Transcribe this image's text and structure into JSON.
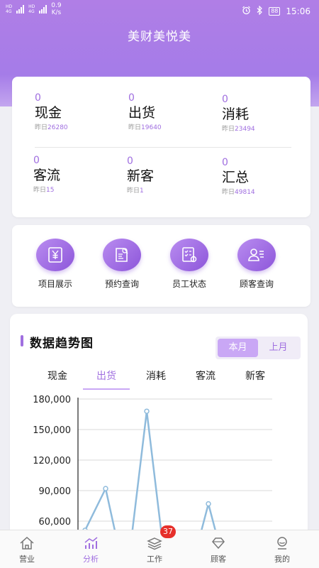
{
  "status_bar": {
    "signal1": "HD",
    "signal1_sub": "4G",
    "signal2": "HD",
    "signal2_sub": "4G",
    "speed_value": "0.9",
    "speed_unit": "K/s",
    "battery": "88",
    "time": "15:06"
  },
  "app_title": "美财美悦美",
  "stats": [
    {
      "value": "0",
      "name": "现金",
      "prev_label": "昨日",
      "prev_value": "26280"
    },
    {
      "value": "0",
      "name": "出货",
      "prev_label": "昨日",
      "prev_value": "19640"
    },
    {
      "value": "0",
      "name": "消耗",
      "prev_label": "昨日",
      "prev_value": "23494"
    },
    {
      "value": "0",
      "name": "客流",
      "prev_label": "昨日",
      "prev_value": "15"
    },
    {
      "value": "0",
      "name": "新客",
      "prev_label": "昨日",
      "prev_value": "1"
    },
    {
      "value": "0",
      "name": "汇总",
      "prev_label": "昨日",
      "prev_value": "49814"
    }
  ],
  "menu": [
    {
      "label": "项目展示",
      "icon": "yuan-document-icon"
    },
    {
      "label": "预约查询",
      "icon": "search-document-icon"
    },
    {
      "label": "员工状态",
      "icon": "checklist-gear-icon"
    },
    {
      "label": "顾客查询",
      "icon": "user-card-icon"
    }
  ],
  "trend": {
    "title": "数据趋势图",
    "period_options": [
      "本月",
      "上月"
    ],
    "period_selected": "本月",
    "tabs": [
      "现金",
      "出货",
      "消耗",
      "客流",
      "新客"
    ],
    "tab_selected": "出货"
  },
  "chart_data": {
    "type": "line",
    "title": "",
    "xlabel": "",
    "ylabel": "",
    "ylim": [
      45000,
      180000
    ],
    "yticks": [
      "180,000",
      "150,000",
      "120,000",
      "90,000",
      "60,000"
    ],
    "ytick_values": [
      180000,
      150000,
      120000,
      90000,
      60000
    ],
    "grid": true,
    "series": [
      {
        "color": "#8fbbdc",
        "values": [
          {
            "x": 0,
            "y": 0
          },
          {
            "x": 1,
            "y": 0
          },
          {
            "x": 2,
            "y": 51000
          },
          {
            "x": 3,
            "y": 92000
          },
          {
            "x": 4,
            "y": 0
          },
          {
            "x": 5,
            "y": 168000
          },
          {
            "x": 6,
            "y": 0
          },
          {
            "x": 7,
            "y": 0
          },
          {
            "x": 8,
            "y": 77000
          },
          {
            "x": 9,
            "y": 0
          }
        ]
      }
    ]
  },
  "bottom_nav": [
    {
      "label": "营业",
      "icon": "home-icon"
    },
    {
      "label": "分析",
      "icon": "chart-icon"
    },
    {
      "label": "工作",
      "icon": "layers-icon",
      "badge": "37"
    },
    {
      "label": "顾客",
      "icon": "diamond-icon"
    },
    {
      "label": "我的",
      "icon": "person-icon"
    }
  ],
  "bottom_nav_active": "分析",
  "colors": {
    "accent": "#a06fe0",
    "accent_light": "#c9a7f5",
    "header": "#a57ce8",
    "line": "#8fbbdc",
    "badge": "#e6302b"
  }
}
